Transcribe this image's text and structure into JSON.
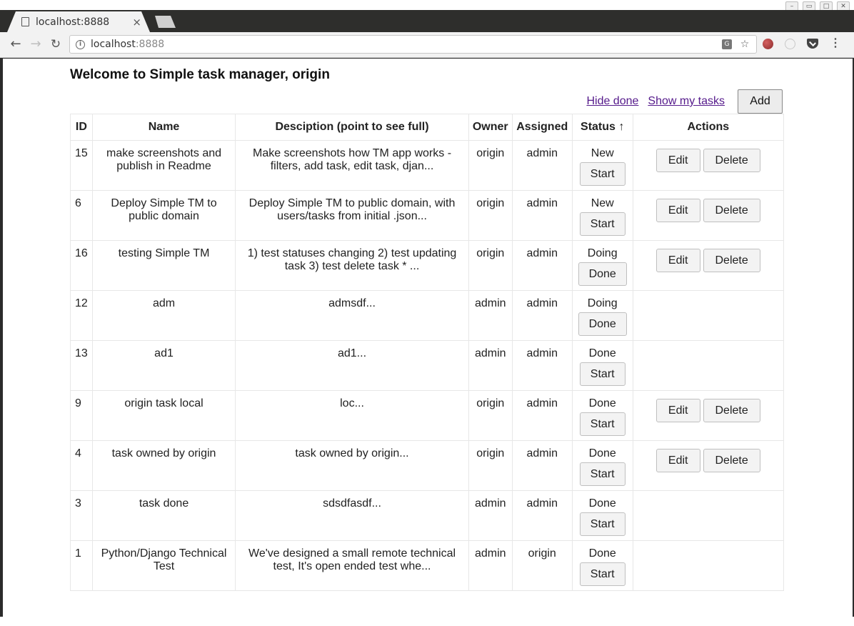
{
  "browser": {
    "tab_title": "localhost:8888",
    "tab_close": "×",
    "url_host": "localhost",
    "url_port": ":8888",
    "back_glyph": "←",
    "forward_glyph": "→",
    "reload_glyph": "↻",
    "star_glyph": "☆",
    "menu_glyph": "⋮",
    "info_glyph": "i",
    "translate_glyph": "G"
  },
  "page": {
    "title": "Welcome to Simple task manager, origin",
    "hide_done_label": "Hide done",
    "show_my_tasks_label": "Show my tasks",
    "add_label": "Add"
  },
  "table": {
    "headers": {
      "id": "ID",
      "name": "Name",
      "description": "Desciption (point to see full)",
      "owner": "Owner",
      "assigned": "Assigned",
      "status": "Status ↑",
      "actions": "Actions"
    },
    "edit_label": "Edit",
    "delete_label": "Delete",
    "rows": [
      {
        "id": "15",
        "name": "make screenshots and publish in Readme",
        "description": "Make screenshots how TM app works - filters, add task, edit task, djan...",
        "owner": "origin",
        "assigned": "admin",
        "status": "New",
        "status_action": "Start",
        "can_edit": true
      },
      {
        "id": "6",
        "name": "Deploy Simple TM to public domain",
        "description": "Deploy Simple TM to public domain, with users/tasks from initial .json...",
        "owner": "origin",
        "assigned": "admin",
        "status": "New",
        "status_action": "Start",
        "can_edit": true
      },
      {
        "id": "16",
        "name": "testing Simple TM",
        "description": "1) test statuses changing 2) test updating task 3) test delete task * ...",
        "owner": "origin",
        "assigned": "admin",
        "status": "Doing",
        "status_action": "Done",
        "can_edit": true
      },
      {
        "id": "12",
        "name": "adm",
        "description": "admsdf...",
        "owner": "admin",
        "assigned": "admin",
        "status": "Doing",
        "status_action": "Done",
        "can_edit": false
      },
      {
        "id": "13",
        "name": "ad1",
        "description": "ad1...",
        "owner": "admin",
        "assigned": "admin",
        "status": "Done",
        "status_action": "Start",
        "can_edit": false
      },
      {
        "id": "9",
        "name": "origin task local",
        "description": "loc...",
        "owner": "origin",
        "assigned": "admin",
        "status": "Done",
        "status_action": "Start",
        "can_edit": true
      },
      {
        "id": "4",
        "name": "task owned by origin",
        "description": "task owned by origin...",
        "owner": "origin",
        "assigned": "admin",
        "status": "Done",
        "status_action": "Start",
        "can_edit": true
      },
      {
        "id": "3",
        "name": "task done",
        "description": "sdsdfasdf...",
        "owner": "admin",
        "assigned": "admin",
        "status": "Done",
        "status_action": "Start",
        "can_edit": false
      },
      {
        "id": "1",
        "name": "Python/Django Technical Test",
        "description": "We've designed a small remote technical test, It's open ended test whe...",
        "owner": "admin",
        "assigned": "origin",
        "status": "Done",
        "status_action": "Start",
        "can_edit": false
      }
    ]
  }
}
